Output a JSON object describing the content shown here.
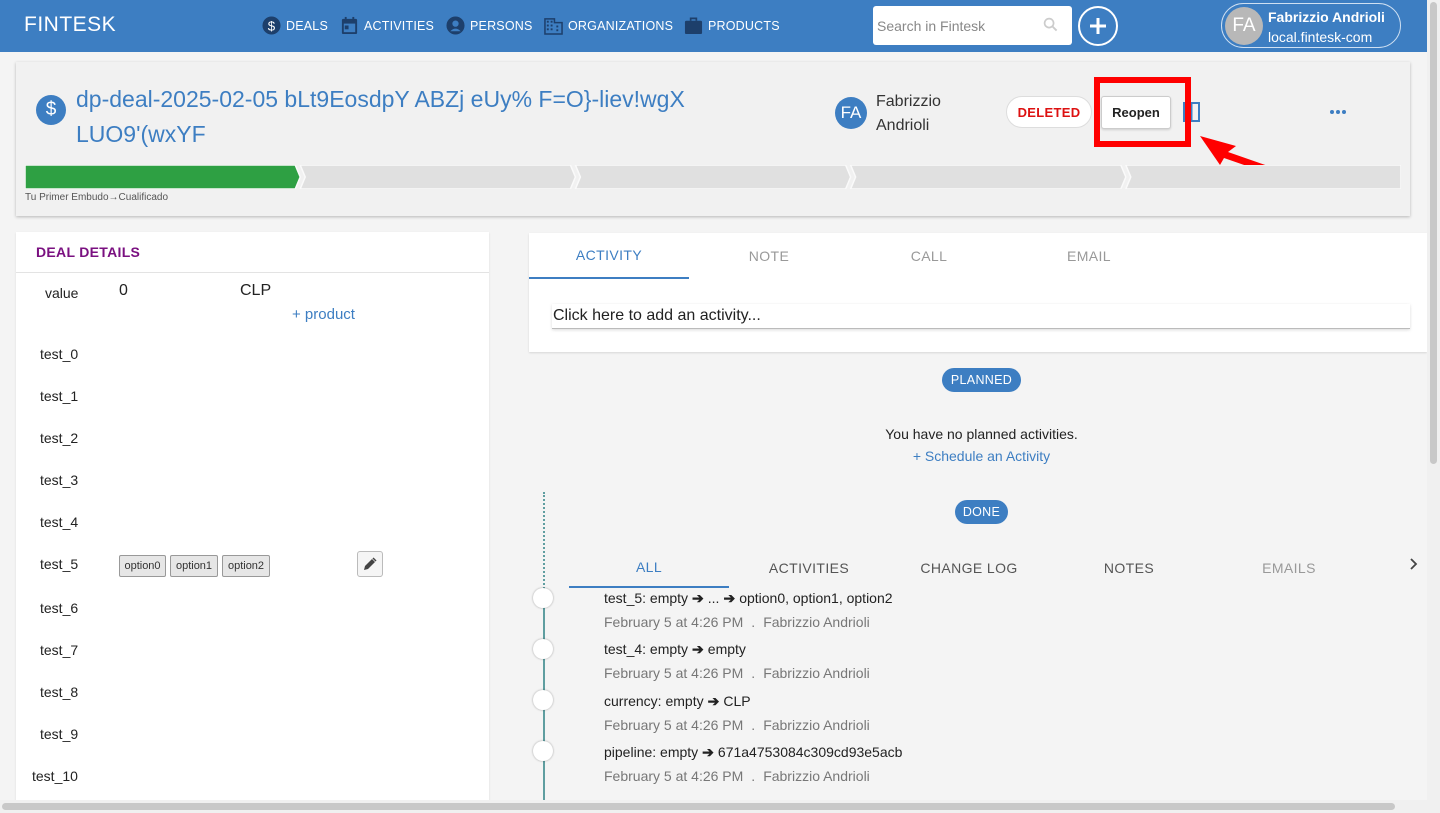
{
  "app": {
    "brand": "FINTESK",
    "nav": [
      {
        "label": "DEALS",
        "icon": "dollar-circle-icon"
      },
      {
        "label": "ACTIVITIES",
        "icon": "calendar-icon"
      },
      {
        "label": "PERSONS",
        "icon": "person-icon"
      },
      {
        "label": "ORGANIZATIONS",
        "icon": "building-icon"
      },
      {
        "label": "PRODUCTS",
        "icon": "briefcase-icon"
      }
    ],
    "search_placeholder": "Search in Fintesk",
    "user": {
      "initials": "FA",
      "name": "Fabrizzio Andrioli",
      "domain": "local.fintesk-com"
    }
  },
  "deal": {
    "title": "dp-deal-2025-02-05 bLt9EosdpY ABZj eUy% F=O}-liev!wgX LUO9'(wxYF",
    "owner_initials": "FA",
    "owner_name": "Fabrizzio Andrioli",
    "status": "DELETED",
    "reopen_label": "Reopen",
    "stage_caption": "Tu Primer Embudo→Cualificado",
    "pipeline_stages": 5,
    "active_stage": 1,
    "colors": {
      "brand": "#3d7ec2",
      "stage_done": "#2ea043",
      "stage_todo": "#e0e0e0",
      "status": "#dd1111",
      "highlight": "#ff0000"
    }
  },
  "details": {
    "title": "DEAL DETAILS",
    "value_label": "value",
    "value_amount": "0",
    "currency": "CLP",
    "add_product": "+ product",
    "fields": [
      "test_0",
      "test_1",
      "test_2",
      "test_3",
      "test_4",
      "test_5",
      "test_6",
      "test_7",
      "test_8",
      "test_9",
      "test_10"
    ],
    "test_5_options": [
      "option0",
      "option1",
      "option2"
    ]
  },
  "composer": {
    "tabs": [
      "ACTIVITY",
      "NOTE",
      "CALL",
      "EMAIL"
    ],
    "active_tab": "ACTIVITY",
    "placeholder": "Click here to add an activity..."
  },
  "timeline": {
    "planned_label": "PLANNED",
    "no_planned": "You have no planned activities.",
    "schedule_link": "+ Schedule an Activity",
    "done_label": "DONE",
    "history_tabs": [
      "ALL",
      "ACTIVITIES",
      "CHANGE LOG",
      "NOTES",
      "EMAILS"
    ],
    "active_history_tab": "ALL",
    "entries": [
      {
        "field": "test_5:",
        "from": "empty",
        "mid": "...",
        "to": "option0, option1, option2",
        "date": "February 5 at 4:26 PM",
        "sep": ".",
        "author": "Fabrizzio Andrioli"
      },
      {
        "field": "test_4:",
        "from": "empty",
        "to": "empty",
        "date": "February 5 at 4:26 PM",
        "sep": ".",
        "author": "Fabrizzio Andrioli"
      },
      {
        "field": "currency:",
        "from": "empty",
        "to": "CLP",
        "date": "February 5 at 4:26 PM",
        "sep": ".",
        "author": "Fabrizzio Andrioli"
      },
      {
        "field": "pipeline:",
        "from": "empty",
        "to": "671a4753084c309cd93e5acb",
        "date": "February 5 at 4:26 PM",
        "sep": ".",
        "author": "Fabrizzio Andrioli"
      }
    ]
  }
}
